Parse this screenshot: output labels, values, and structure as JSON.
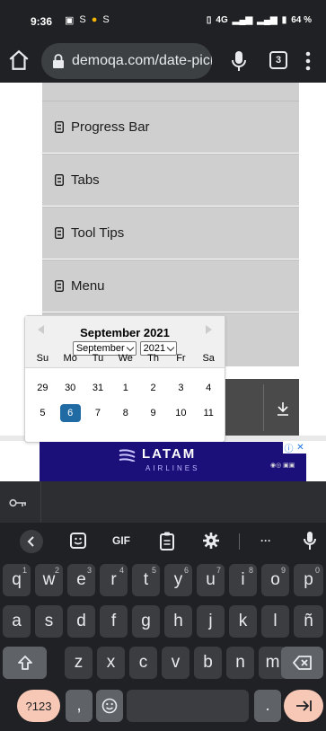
{
  "status_bar": {
    "time": "9:36",
    "left_icons": [
      "▣",
      "S",
      "●",
      "S"
    ],
    "network": "4G",
    "battery": "64 %"
  },
  "browser": {
    "url": "demoqa.com/date-picker",
    "tab_count": "3"
  },
  "sidebar": {
    "items": [
      {
        "label": ""
      },
      {
        "label": "Progress Bar"
      },
      {
        "label": "Tabs"
      },
      {
        "label": "Tool Tips"
      },
      {
        "label": "Menu"
      }
    ]
  },
  "datepicker": {
    "title": "September 2021",
    "month_select": "September",
    "year_select": "2021",
    "weekdays": [
      "Su",
      "Mo",
      "Tu",
      "We",
      "Th",
      "Fr",
      "Sa"
    ],
    "weeks": [
      [
        "29",
        "30",
        "31",
        "1",
        "2",
        "3",
        "4"
      ],
      [
        "5",
        "6",
        "7",
        "8",
        "9",
        "10",
        "11"
      ]
    ],
    "selected_day": "6"
  },
  "ad": {
    "brand": "LATAM",
    "sub": "AIRLINES"
  },
  "keyboard": {
    "tools": [
      "GIF",
      "···"
    ],
    "row1": [
      {
        "k": "q",
        "h": "1"
      },
      {
        "k": "w",
        "h": "2"
      },
      {
        "k": "e",
        "h": "3"
      },
      {
        "k": "r",
        "h": "4"
      },
      {
        "k": "t",
        "h": "5"
      },
      {
        "k": "y",
        "h": "6"
      },
      {
        "k": "u",
        "h": "7"
      },
      {
        "k": "i",
        "h": "8"
      },
      {
        "k": "o",
        "h": "9"
      },
      {
        "k": "p",
        "h": "0"
      }
    ],
    "row2": [
      "a",
      "s",
      "d",
      "f",
      "g",
      "h",
      "j",
      "k",
      "l",
      "ñ"
    ],
    "row3": [
      "z",
      "x",
      "c",
      "v",
      "b",
      "n",
      "m"
    ],
    "symbols_label": "?123",
    "comma": ",",
    "period": "."
  },
  "colors": {
    "selected_day_bg": "#216ba5",
    "menu_bg": "#cfcfcf",
    "ad_bg": "#1b0f7a",
    "accent_key": "#f7c8b6"
  }
}
